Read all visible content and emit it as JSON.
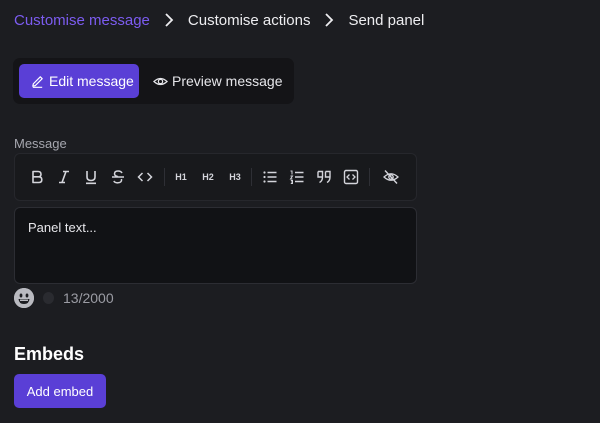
{
  "breadcrumb": {
    "items": [
      "Customise message",
      "Customise actions",
      "Send panel"
    ],
    "active_index": 0
  },
  "mode_toggle": {
    "edit_label": "Edit message",
    "preview_label": "Preview message",
    "selected": "edit"
  },
  "message_field": {
    "label": "Message",
    "placeholder": "Panel text...",
    "char_count": "13/2000"
  },
  "toolbar": {
    "tools": [
      {
        "name": "bold-icon",
        "label": "B"
      },
      {
        "name": "italic-icon",
        "label": "I"
      },
      {
        "name": "underline-icon",
        "label": "U"
      },
      {
        "name": "strikethrough-icon",
        "label": "S"
      },
      {
        "name": "code-icon",
        "label": "<>"
      },
      {
        "name": "heading-1",
        "label": "H1"
      },
      {
        "name": "heading-2",
        "label": "H2"
      },
      {
        "name": "heading-3",
        "label": "H3"
      },
      {
        "name": "bulleted-list-icon",
        "label": ""
      },
      {
        "name": "numbered-list-icon",
        "label": ""
      },
      {
        "name": "quote-icon",
        "label": ""
      },
      {
        "name": "code-block-icon",
        "label": ""
      },
      {
        "name": "spoiler-icon",
        "label": ""
      }
    ]
  },
  "embeds": {
    "title": "Embeds",
    "add_label": "Add embed"
  },
  "colors": {
    "background": "#1c1d21",
    "accent": "#5a3fd6",
    "active_crumb": "#7c5cf0"
  }
}
